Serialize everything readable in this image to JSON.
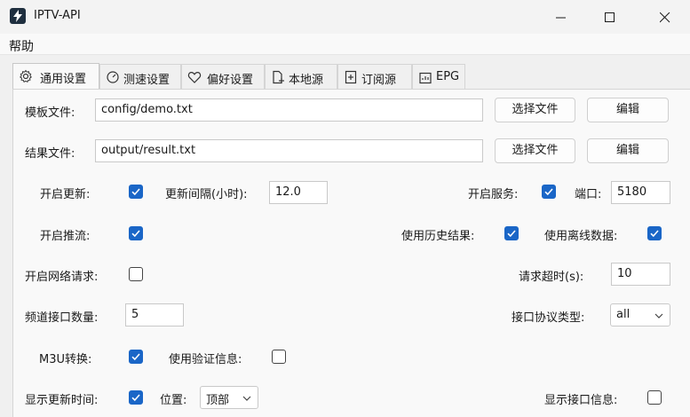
{
  "window": {
    "title": "IPTV-API"
  },
  "menu": {
    "help": "帮助"
  },
  "tabs": [
    {
      "label": "通用设置",
      "icon": "gear-icon",
      "active": true
    },
    {
      "label": "测速设置",
      "icon": "speedometer-icon"
    },
    {
      "label": "偏好设置",
      "icon": "heart-icon"
    },
    {
      "label": "本地源",
      "icon": "local-file-icon"
    },
    {
      "label": "订阅源",
      "icon": "subscribe-icon"
    },
    {
      "label": "EPG",
      "icon": "epg-icon"
    }
  ],
  "general": {
    "template_file_label": "模板文件:",
    "template_file_value": "config/demo.txt",
    "result_file_label": "结果文件:",
    "result_file_value": "output/result.txt",
    "select_file_label": "选择文件",
    "edit_label": "编辑",
    "open_update_label": "开启更新:",
    "update_interval_label": "更新间隔(小时):",
    "update_interval_value": "12.0",
    "open_service_label": "开启服务:",
    "port_label": "端口:",
    "port_value": "5180",
    "open_push_label": "开启推流:",
    "use_history_label": "使用历史结果:",
    "use_offline_label": "使用离线数据:",
    "open_network_label": "开启网络请求:",
    "request_timeout_label": "请求超时(s):",
    "request_timeout_value": "10",
    "channel_count_label": "频道接口数量:",
    "channel_count_value": "5",
    "protocol_type_label": "接口协议类型:",
    "protocol_type_value": "all",
    "m3u_label": "M3U转换:",
    "auth_label": "使用验证信息:",
    "show_update_time_label": "显示更新时间:",
    "position_label": "位置:",
    "position_value": "顶部",
    "show_interface_label": "显示接口信息:"
  },
  "colors": {
    "accent": "#1a66c7"
  }
}
